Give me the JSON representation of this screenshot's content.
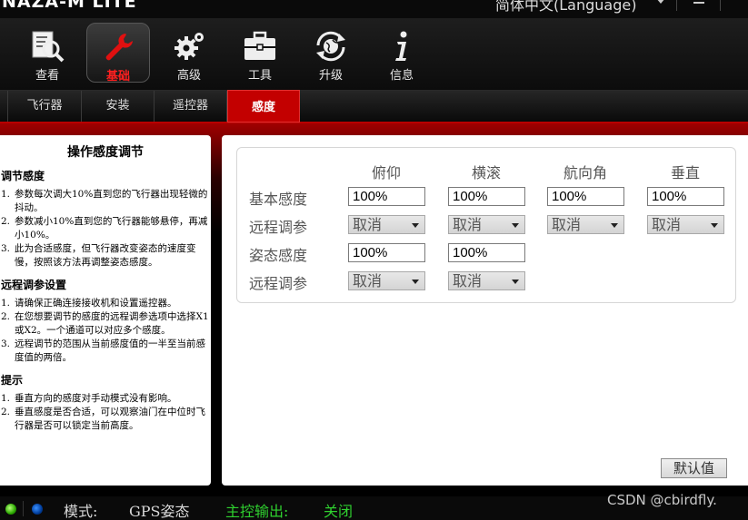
{
  "titlebar": {
    "app_title": "NAZA-M LITE",
    "language": "简体中文(Language)"
  },
  "toolbar": {
    "items": [
      {
        "label": "查看",
        "icon": "view-icon"
      },
      {
        "label": "基础",
        "icon": "wrench-icon"
      },
      {
        "label": "高级",
        "icon": "gears-icon"
      },
      {
        "label": "工具",
        "icon": "toolbox-icon"
      },
      {
        "label": "升级",
        "icon": "upgrade-globe-icon"
      },
      {
        "label": "信息",
        "icon": "info-icon"
      }
    ],
    "active": "基础"
  },
  "subtabs": {
    "items": [
      "飞行器",
      "安装",
      "遥控器",
      "感度"
    ],
    "active": "感度"
  },
  "help": {
    "title": "操作感度调节",
    "sections": [
      {
        "heading": "调节感度",
        "items": [
          "参数每次调大10%直到您的飞行器出现轻微的抖动。",
          "参数减小10%直到您的飞行器能够悬停，再减小10%。",
          "此为合适感度，但飞行器改变姿态的速度变慢，按照该方法再调整姿态感度。"
        ]
      },
      {
        "heading": "远程调参设置",
        "items": [
          "请确保正确连接接收机和设置遥控器。",
          "在您想要调节的感度的远程调参选项中选择X1或X2。一个通道可以对应多个感度。",
          "远程调节的范围从当前感度值的一半至当前感度值的两倍。"
        ]
      },
      {
        "heading": "提示",
        "items": [
          "垂直方向的感度对手动模式没有影响。",
          "垂直感度是否合适，可以观察油门在中位时飞行器是否可以锁定当前高度。"
        ]
      }
    ]
  },
  "gains": {
    "columns": [
      "俯仰",
      "横滚",
      "航向角",
      "垂直"
    ],
    "rows": {
      "basic_label": "基本感度",
      "remote1_label": "远程调参",
      "attitude_label": "姿态感度",
      "remote2_label": "远程调参"
    },
    "basic": [
      "100%",
      "100%",
      "100%",
      "100%"
    ],
    "remote1": [
      "取消",
      "取消",
      "取消",
      "取消"
    ],
    "attitude": [
      "100%",
      "100%"
    ],
    "remote2": [
      "取消",
      "取消"
    ],
    "default_button": "默认值"
  },
  "status": {
    "mode_label": "模式:",
    "mode_value": "GPS姿态",
    "output_label": "主控输出:",
    "output_value": "关闭",
    "accent_green": "#2fd02f"
  },
  "watermark": "CSDN @cbirdfly."
}
